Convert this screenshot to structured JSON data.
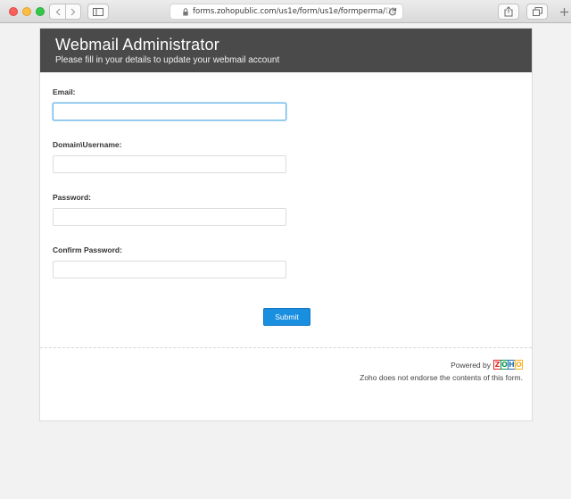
{
  "browser": {
    "url_main": "forms.zohopublic.com/us1e/form/us1e/formperma/",
    "url_faded": "DB",
    "colors": {
      "close": "#fc605c",
      "minimize": "#fdbc40",
      "maximize": "#34c84a"
    }
  },
  "form": {
    "title": "Webmail Administrator",
    "subtitle": "Please fill in your details to update your webmail account",
    "fields": [
      {
        "label": "Email:",
        "value": "",
        "focused": true
      },
      {
        "label": "Domain\\Username:",
        "value": ""
      },
      {
        "label": "Password:",
        "value": ""
      },
      {
        "label": "Confirm Password:",
        "value": ""
      }
    ],
    "submit_label": "Submit",
    "accent_color": "#1a8fe0",
    "header_color": "#4a4a4a"
  },
  "footer": {
    "powered_by": "Powered by",
    "logo_letters": [
      {
        "letter": "Z",
        "color": "#e42527"
      },
      {
        "letter": "O",
        "color": "#089949"
      },
      {
        "letter": "H",
        "color": "#226db4"
      },
      {
        "letter": "O",
        "color": "#f9b21d"
      }
    ],
    "disclaimer": "Zoho does not endorse the contents of this form."
  }
}
